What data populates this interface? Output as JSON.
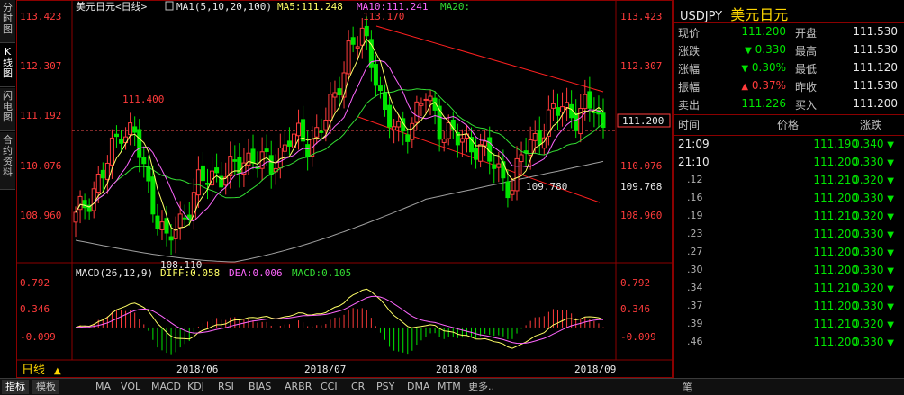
{
  "left_tabs": [
    {
      "label": "分时图",
      "active": false
    },
    {
      "label": "K线图",
      "active": true
    },
    {
      "label": "闪电图",
      "active": false
    },
    {
      "label": "合约资料",
      "active": false
    }
  ],
  "chart": {
    "legend": {
      "name": "美元日元<日线>",
      "ma_params": "MA1(5,10,20,100)",
      "ma5": "MA5:111.248",
      "ma10": "MA10:111.241",
      "ma20": "MA20:"
    },
    "price_ticks": [
      "113.423",
      "112.307",
      "111.192",
      "110.076",
      "108.960"
    ],
    "right_ticks": [
      "113.423",
      "112.307",
      "111.192",
      "110.076",
      "108.960"
    ],
    "current_price_box": "111.200",
    "mark_109768": "109.768",
    "annotations": {
      "high": "113.170",
      "left_high": "111.400",
      "low": "108.110",
      "right_low": "109.780"
    },
    "macd_legend": {
      "params": "MACD(26,12,9)",
      "diff": "DIFF:0.058",
      "dea": "DEA:0.006",
      "macd": "MACD:0.105"
    },
    "macd_ticks": [
      "0.792",
      "0.346",
      "-0.099"
    ],
    "date_labels": [
      "2018/06",
      "2018/07",
      "2018/08",
      "2018/09"
    ],
    "period_label": "日线"
  },
  "chart_data": {
    "type": "candlestick",
    "title": "美元日元<日线>",
    "ylim": [
      108.6,
      113.6
    ],
    "y_ticks": [
      113.423,
      112.307,
      111.192,
      110.076,
      108.96
    ],
    "x_ticks": [
      "2018/06",
      "2018/07",
      "2018/08",
      "2018/09"
    ],
    "reference_line": 111.192,
    "annotations": [
      {
        "label": "113.170",
        "value": 113.17
      },
      {
        "label": "111.400",
        "value": 111.4
      },
      {
        "label": "108.110",
        "value": 108.11
      },
      {
        "label": "109.780",
        "value": 109.78
      }
    ],
    "macd": {
      "ylim": [
        -0.6,
        0.95
      ],
      "y_ticks": [
        0.792,
        0.346,
        -0.099
      ]
    }
  },
  "bottom_tabs": [
    "指标",
    "模板",
    "MA",
    "VOL",
    "MACD",
    "KDJ",
    "RSI",
    "BIAS",
    "ARBR",
    "CCI",
    "CR",
    "PSY",
    "DMA",
    "MTM",
    "更多.."
  ],
  "panel": {
    "symbol": "USDJPY",
    "name": "美元日元",
    "quote_rows": [
      {
        "l1": "现价",
        "v1": "111.200",
        "c1": "g",
        "a1": "",
        "l2": "开盘",
        "v2": "111.530",
        "c2": "w"
      },
      {
        "l1": "涨跌",
        "v1": "0.330",
        "c1": "g",
        "a1": "down",
        "l2": "最高",
        "v2": "111.530",
        "c2": "w"
      },
      {
        "l1": "涨幅",
        "v1": "0.30%",
        "c1": "g",
        "a1": "down",
        "l2": "最低",
        "v2": "111.120",
        "c2": "w"
      },
      {
        "l1": "振幅",
        "v1": "0.37%",
        "c1": "r",
        "a1": "up",
        "l2": "昨收",
        "v2": "111.530",
        "c2": "w"
      },
      {
        "l1": "卖出",
        "v1": "111.226",
        "c1": "g",
        "a1": "",
        "l2": "买入",
        "v2": "111.200",
        "c2": "w"
      }
    ],
    "tick_header": {
      "time": "时间",
      "price": "价格",
      "change": "涨跌"
    },
    "ticks": [
      {
        "time": "21:09",
        "price": "111.190",
        "change": "0.340"
      },
      {
        "time": "21:10",
        "price": "111.200",
        "change": "0.330"
      },
      {
        "time": ".12",
        "price": "111.210",
        "change": "0.320"
      },
      {
        "time": ".16",
        "price": "111.200",
        "change": "0.330"
      },
      {
        "time": ".19",
        "price": "111.210",
        "change": "0.320"
      },
      {
        "time": ".23",
        "price": "111.200",
        "change": "0.330"
      },
      {
        "time": ".27",
        "price": "111.200",
        "change": "0.330"
      },
      {
        "time": ".30",
        "price": "111.200",
        "change": "0.330"
      },
      {
        "time": ".34",
        "price": "111.210",
        "change": "0.320"
      },
      {
        "time": ".37",
        "price": "111.200",
        "change": "0.330"
      },
      {
        "time": ".39",
        "price": "111.210",
        "change": "0.320"
      },
      {
        "time": ".46",
        "price": "111.200",
        "change": "0.330"
      }
    ],
    "footer_label": "笔"
  },
  "colors": {
    "up": "#ff3b3b",
    "down": "#00e600",
    "ma5": "#ffff66",
    "ma10": "#ff66ff",
    "ma20": "#33dd33",
    "ma100": "#a0a0a0"
  }
}
